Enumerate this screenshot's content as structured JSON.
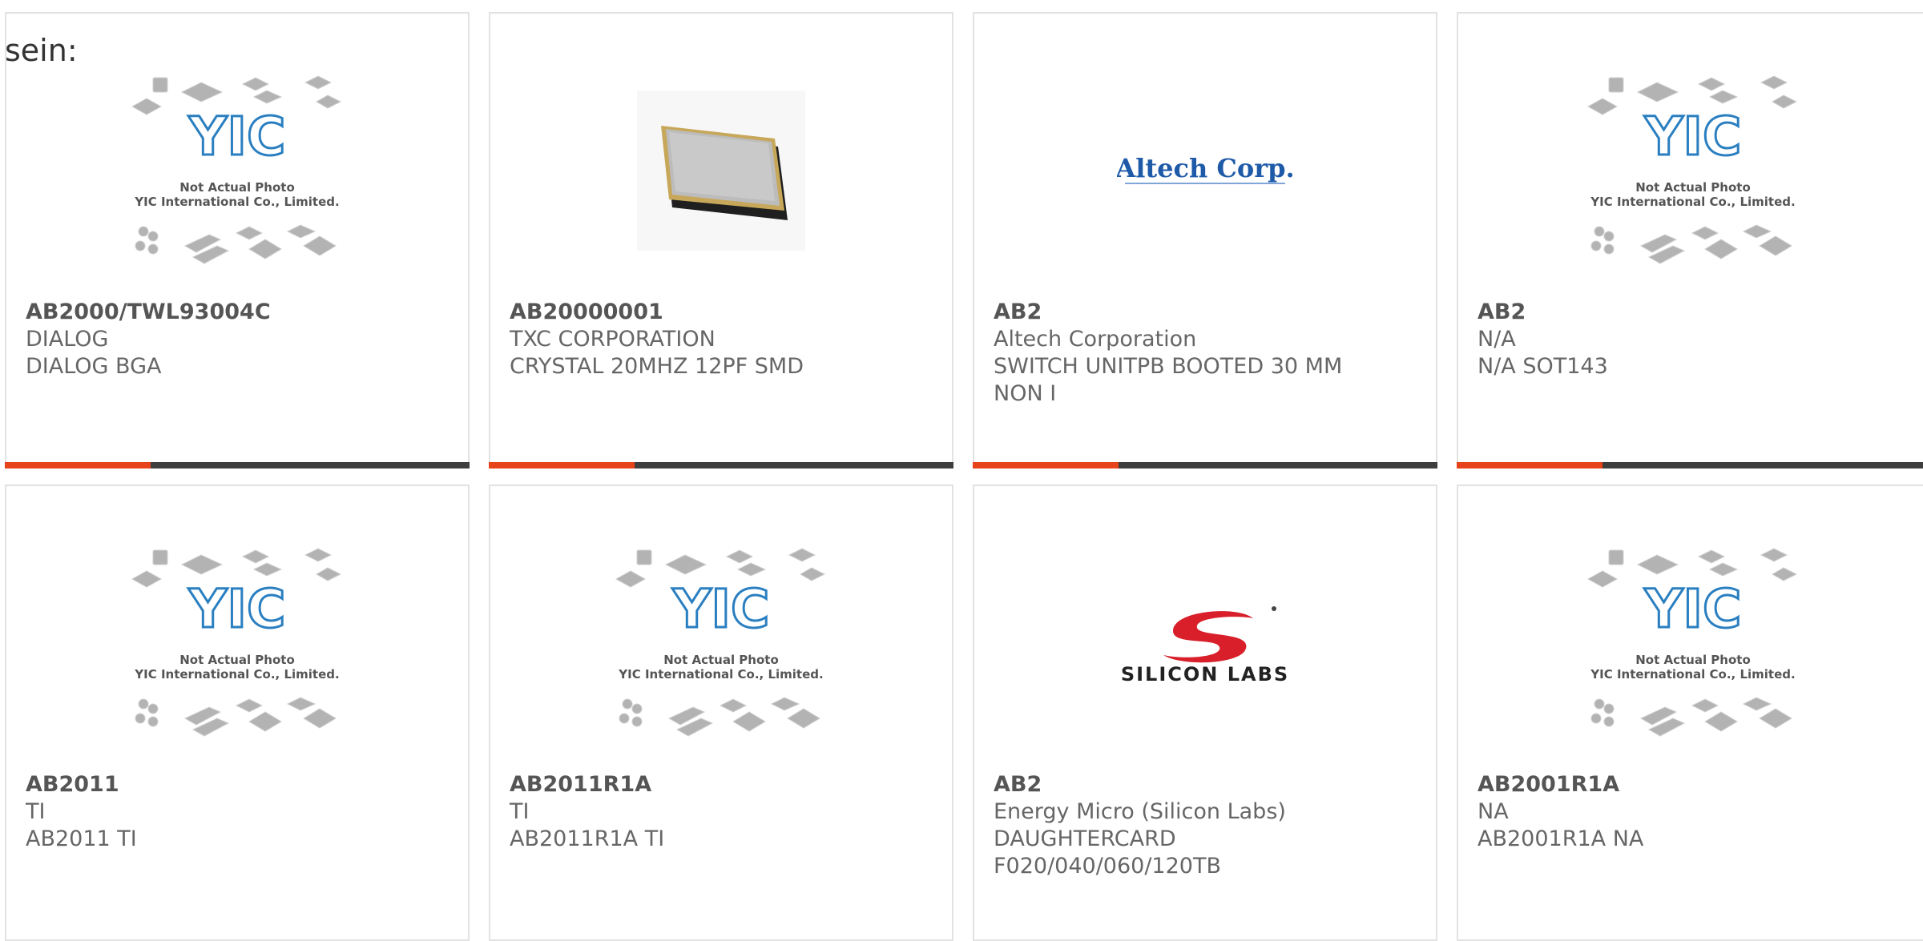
{
  "intro_text": "sein:",
  "colors": {
    "accent": "#e8441b",
    "bar": "#3e3e3e",
    "border": "#e2e2e2",
    "text": "#666666",
    "yic_blue": "#2a7fc1"
  },
  "placeholder": {
    "line1": "Not Actual Photo",
    "line2": "YIC International Co., Limited."
  },
  "products": [
    {
      "part": "AB2000/TWL93004C",
      "manufacturer": "DIALOG",
      "desc1": "DIALOG BGA",
      "desc2": "",
      "image": "yic-placeholder"
    },
    {
      "part": "AB20000001",
      "manufacturer": "TXC CORPORATION",
      "desc1": "CRYSTAL 20MHZ 12PF SMD",
      "desc2": "",
      "image": "crystal-photo"
    },
    {
      "part": "AB2",
      "manufacturer": "Altech Corporation",
      "desc1": "SWITCH UNITPB BOOTED 30 MM",
      "desc2": "NON I",
      "image": "altech-logo",
      "logo_text": "Altech Corp."
    },
    {
      "part": "AB2",
      "manufacturer": "N/A",
      "desc1": "N/A SOT143",
      "desc2": "",
      "image": "yic-placeholder"
    },
    {
      "part": "AB2011",
      "manufacturer": "TI",
      "desc1": "AB2011 TI",
      "desc2": "",
      "image": "yic-placeholder"
    },
    {
      "part": "AB2011R1A",
      "manufacturer": "TI",
      "desc1": "AB2011R1A TI",
      "desc2": "",
      "image": "yic-placeholder"
    },
    {
      "part": "AB2",
      "manufacturer": "Energy Micro (Silicon Labs)",
      "desc1": "DAUGHTERCARD",
      "desc2": "F020/040/060/120TB",
      "image": "silicon-labs-logo",
      "logo_text": "SILICON LABS"
    },
    {
      "part": "AB2001R1A",
      "manufacturer": "NA",
      "desc1": "AB2001R1A NA",
      "desc2": "",
      "image": "yic-placeholder"
    }
  ]
}
